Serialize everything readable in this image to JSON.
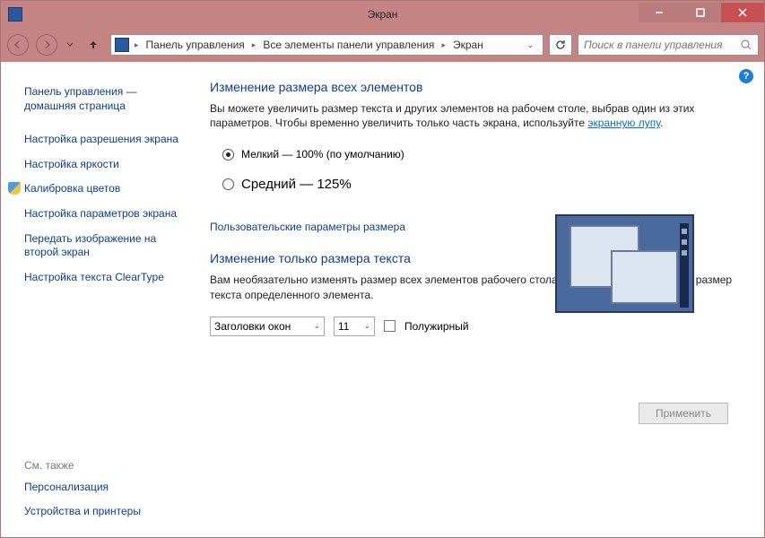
{
  "window": {
    "title": "Экран"
  },
  "breadcrumb": {
    "items": [
      "Панель управления",
      "Все элементы панели управления",
      "Экран"
    ]
  },
  "search": {
    "placeholder": "Поиск в панели управления"
  },
  "sidebar": {
    "home": "Панель управления — домашняя страница",
    "links": [
      "Настройка разрешения экрана",
      "Настройка яркости",
      "Калибровка цветов",
      "Настройка параметров экрана",
      "Передать изображение на второй экран",
      "Настройка текста ClearType"
    ],
    "see_also_heading": "См. также",
    "see_also": [
      "Персонализация",
      "Устройства и принтеры"
    ]
  },
  "main": {
    "heading1": "Изменение размера всех элементов",
    "desc1_pre": "Вы можете увеличить размер текста и других элементов на рабочем столе, выбрав один из этих параметров. Чтобы временно увеличить только часть экрана, используйте ",
    "desc1_link": "экранную лупу",
    "desc1_post": ".",
    "radio1": "Мелкий — 100% (по умолчанию)",
    "radio2": "Средний — 125%",
    "custom_link": "Пользовательские параметры размера",
    "heading2": "Изменение только размера текста",
    "desc2": "Вам необязательно изменять размер всех элементов рабочего стола — можно изменить только размер текста определенного элемента.",
    "select_element": "Заголовки окон",
    "select_size": "11",
    "bold_label": "Полужирный",
    "apply": "Применить"
  },
  "help_icon": "?"
}
